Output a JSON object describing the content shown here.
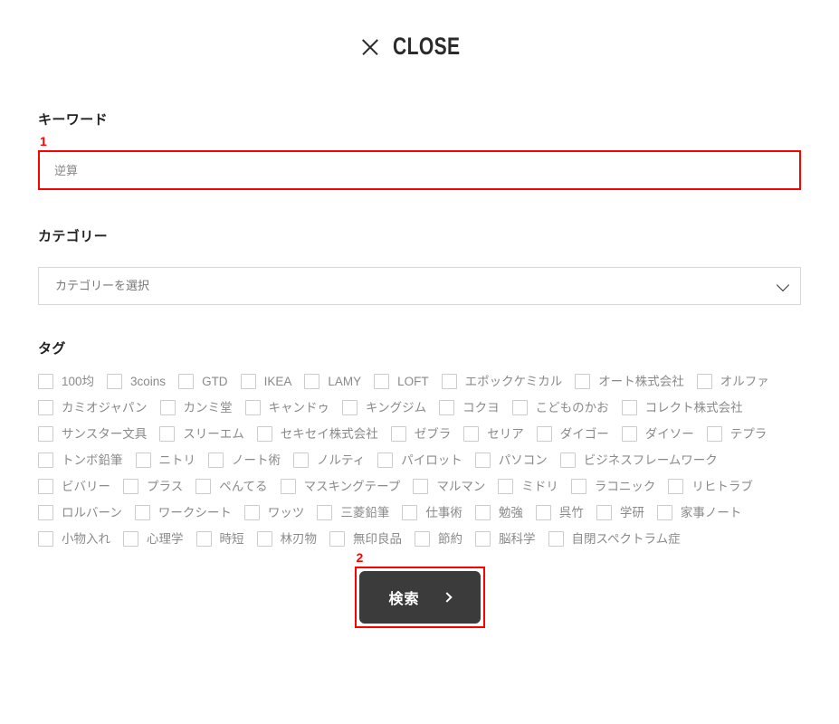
{
  "header": {
    "close_label": "CLOSE",
    "close_icon": "close-icon"
  },
  "form": {
    "keyword": {
      "label": "キーワード",
      "value": "",
      "placeholder": "逆算",
      "annotation": "1"
    },
    "category": {
      "label": "カテゴリー",
      "selected": "カテゴリーを選択",
      "chevron_icon": "chevron-down-icon"
    },
    "tags": {
      "label": "タグ",
      "items": [
        "100均",
        "3coins",
        "GTD",
        "IKEA",
        "LAMY",
        "LOFT",
        "エポックケミカル",
        "オート株式会社",
        "オルファ",
        "カミオジャパン",
        "カンミ堂",
        "キャンドゥ",
        "キングジム",
        "コクヨ",
        "こどものかお",
        "コレクト株式会社",
        "サンスター文具",
        "スリーエム",
        "セキセイ株式会社",
        "ゼブラ",
        "セリア",
        "ダイゴー",
        "ダイソー",
        "テプラ",
        "トンボ鉛筆",
        "ニトリ",
        "ノート術",
        "ノルティ",
        "パイロット",
        "パソコン",
        "ビジネスフレームワーク",
        "ビバリー",
        "プラス",
        "ぺんてる",
        "マスキングテープ",
        "マルマン",
        "ミドリ",
        "ラコニック",
        "リヒトラブ",
        "ロルバーン",
        "ワークシート",
        "ワッツ",
        "三菱鉛筆",
        "仕事術",
        "勉強",
        "呉竹",
        "学研",
        "家事ノート",
        "小物入れ",
        "心理学",
        "時短",
        "林刃物",
        "無印良品",
        "節約",
        "脳科学",
        "自閉スペクトラム症"
      ]
    },
    "submit": {
      "label": "検索",
      "chevron_icon": "chevron-right-icon",
      "annotation": "2"
    }
  },
  "colors": {
    "annotation": "#ff0000",
    "submit_bg": "#3b3b3b",
    "text": "#333333",
    "tag_text": "#8a8a8a"
  }
}
